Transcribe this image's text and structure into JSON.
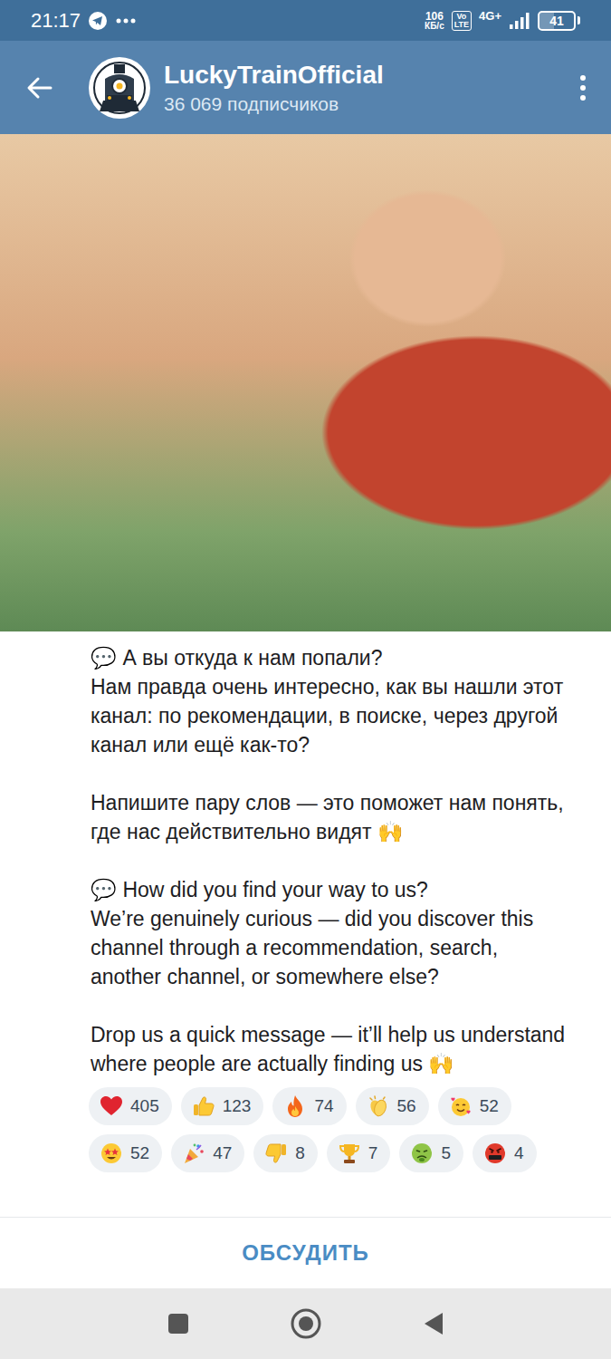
{
  "status_bar": {
    "time": "21:17",
    "speed": "106",
    "speed_unit": "КБ/с",
    "volte_top": "Vo",
    "volte_bottom": "LTE",
    "network": "4G+",
    "battery": "41",
    "battery_level": 0.41
  },
  "header": {
    "title": "LuckyTrainOfficial",
    "subtitle": "36 069 подписчиков"
  },
  "post": {
    "paragraphs": [
      "💬 А вы откуда к нам попали?\nНам правда очень интересно, как вы нашли этот канал: по рекомендации, в поиске, через другой канал или ещё как-то?",
      "Напишите пару слов — это поможет нам понять, где нас действительно видят 🙌",
      "💬 How did you find your way to us?\nWe’re genuinely curious — did you discover this channel through a recommendation, search, another channel, or somewhere else?",
      "Drop us a quick message — it’ll help us understand where people are actually finding us 🙌"
    ],
    "reactions": [
      {
        "kind": "heart",
        "count": "405"
      },
      {
        "kind": "thumbs-up",
        "count": "123"
      },
      {
        "kind": "fire",
        "count": "74"
      },
      {
        "kind": "clap",
        "count": "56"
      },
      {
        "kind": "smiling-hearts",
        "count": "52"
      },
      {
        "kind": "star-struck",
        "count": "52"
      },
      {
        "kind": "party",
        "count": "47"
      },
      {
        "kind": "thumbs-down",
        "count": "8"
      },
      {
        "kind": "trophy",
        "count": "7"
      },
      {
        "kind": "nauseated",
        "count": "5"
      },
      {
        "kind": "cursing",
        "count": "4"
      }
    ]
  },
  "discuss_button": "ОБСУДИТЬ"
}
